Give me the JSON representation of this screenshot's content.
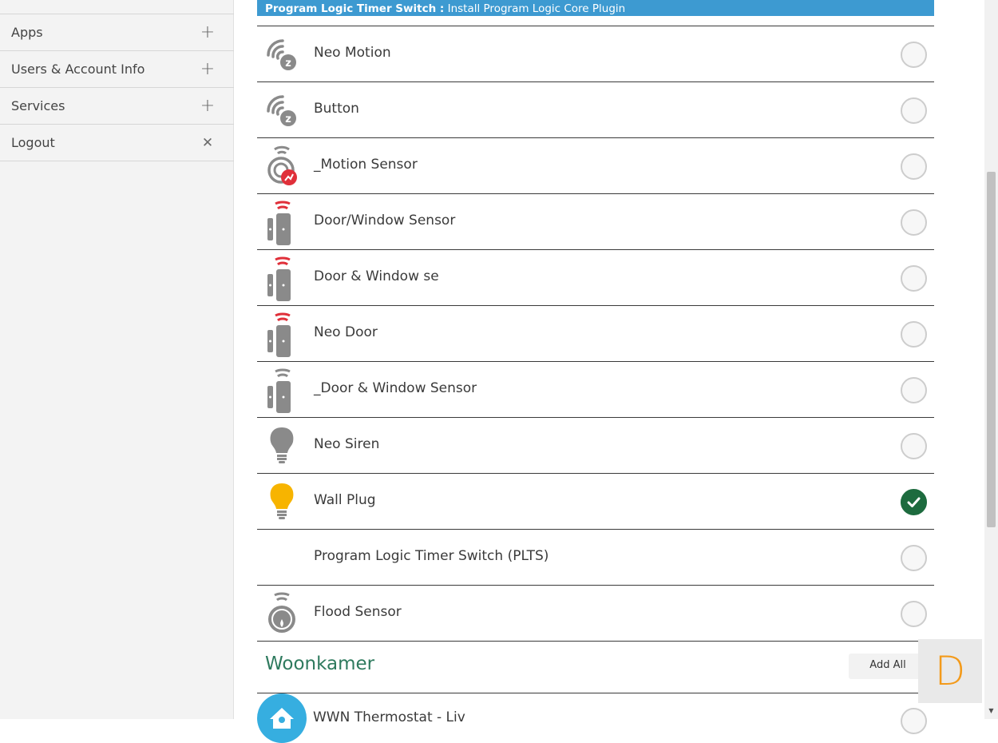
{
  "sidebar": {
    "items": [
      {
        "label": "Apps",
        "action": "+"
      },
      {
        "label": "Users & Account Info",
        "action": "+"
      },
      {
        "label": "Services",
        "action": "+"
      },
      {
        "label": "Logout",
        "action": "✕"
      }
    ]
  },
  "banner": {
    "title": "Program Logic Timer Switch :",
    "message": " Install Program Logic Core Plugin"
  },
  "devices": [
    {
      "name": "Neo Motion",
      "icon": "zwave-icon",
      "selected": false
    },
    {
      "name": "Button",
      "icon": "zwave-icon",
      "selected": false
    },
    {
      "name": "_Motion Sensor",
      "icon": "motion-sensor-icon",
      "selected": false
    },
    {
      "name": "Door/Window Sensor",
      "icon": "door-sensor-icon",
      "selected": false
    },
    {
      "name": "Door & Window se",
      "icon": "door-sensor-icon",
      "selected": false
    },
    {
      "name": "Neo Door",
      "icon": "door-sensor-icon",
      "selected": false
    },
    {
      "name": "_Door & Window Sensor",
      "icon": "door-sensor-gray-icon",
      "selected": false
    },
    {
      "name": "Neo Siren",
      "icon": "bulb-off-icon",
      "selected": false
    },
    {
      "name": "Wall Plug",
      "icon": "bulb-on-icon",
      "selected": true
    },
    {
      "name": "Program Logic Timer Switch (PLTS)",
      "icon": "",
      "selected": false
    },
    {
      "name": "Flood Sensor",
      "icon": "flood-sensor-icon",
      "selected": false
    }
  ],
  "room": {
    "title": "Woonkamer",
    "add_all_label": "Add All",
    "next_device": "WWN Thermostat - Liv"
  },
  "widget": {
    "letter": "D"
  },
  "colors": {
    "banner": "#3d9ad1",
    "check": "#1d6b3e",
    "room_title": "#2e7a5e",
    "bulb_on": "#f7b400",
    "sensor_red": "#e0303a",
    "widget_letter": "#f39a1a"
  }
}
